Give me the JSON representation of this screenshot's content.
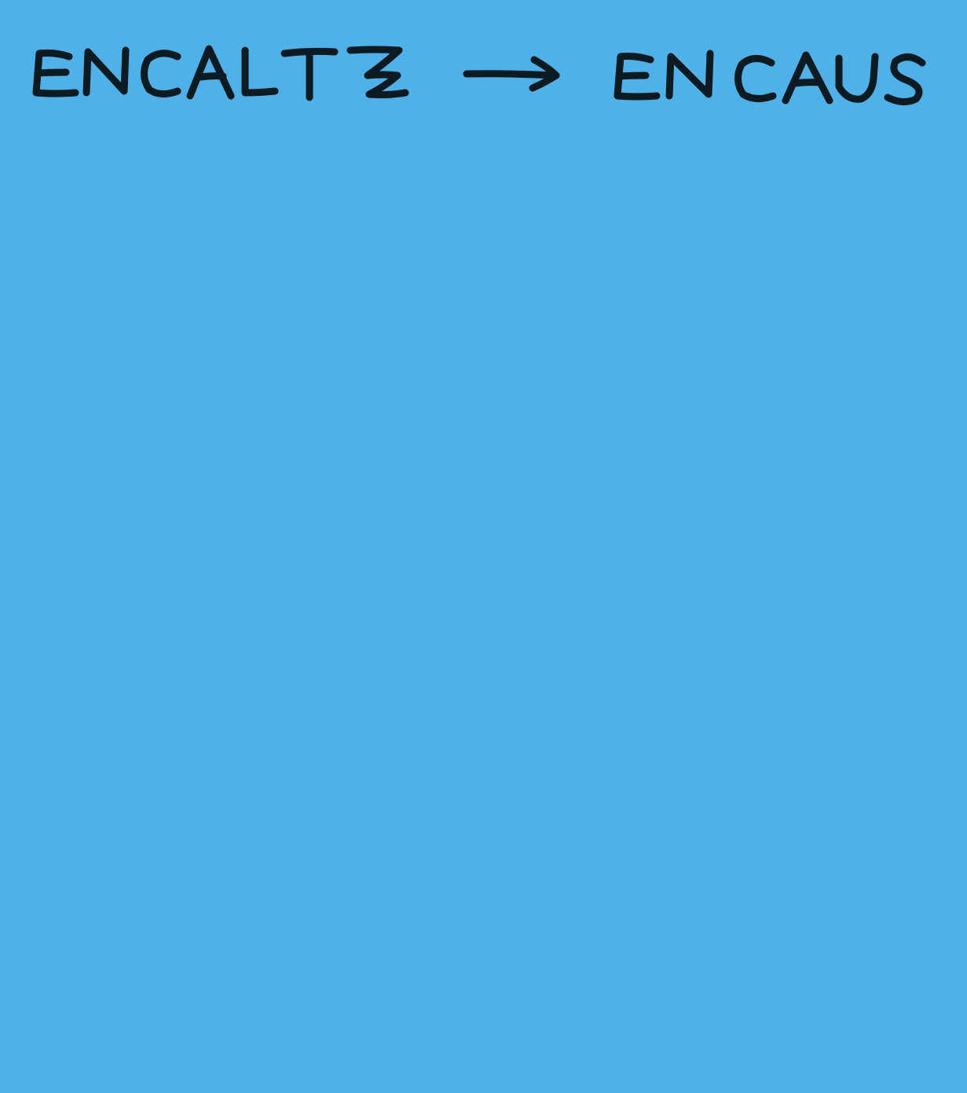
{
  "note": {
    "background_color": "#50b0e8",
    "ink_color": "#0c1a22",
    "source_word": "ENCALTZ",
    "target_word": "ENCAUS",
    "arrow_icon": "right-arrow-icon"
  }
}
